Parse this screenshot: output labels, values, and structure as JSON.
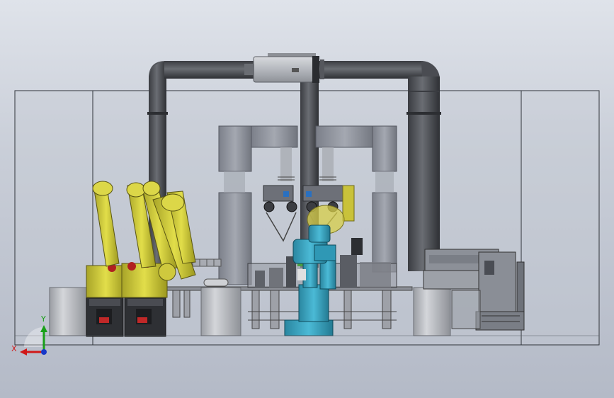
{
  "viewport": {
    "background_top": "#dfe3ea",
    "background_bottom": "#b4bac7"
  },
  "triad": {
    "x_label": "X",
    "y_label": "Y",
    "x_color": "#d01818",
    "y_color": "#18a018",
    "z_color": "#1838c8"
  },
  "colors": {
    "pipe": "#4d4f55",
    "filter": "#c4c6cc",
    "gantry": "#8b8f99",
    "robot_yellow": "#d8d43a",
    "robot_teal": "#3aa5c2",
    "robot_base": "#2e3034",
    "pedestal": "#b8bbc0",
    "enclosure_line": "#30343a"
  },
  "icons": {
    "yellow_robots": "industrial-robot-icon",
    "teal_robot": "industrial-robot-icon",
    "triad": "axis-triad-icon"
  }
}
